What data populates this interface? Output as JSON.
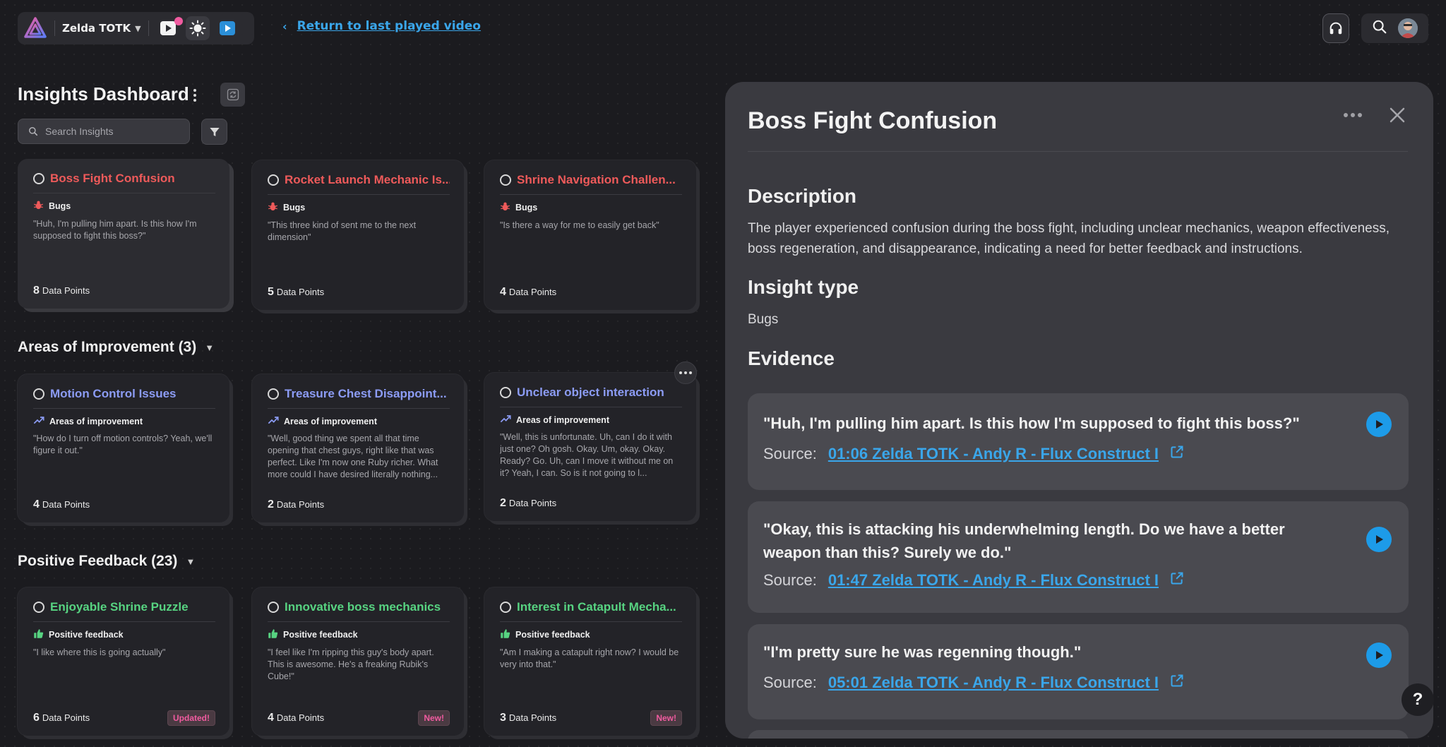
{
  "topbar": {
    "project_name": "Zelda TOTK",
    "return_label": "Return to last played video"
  },
  "dashboard": {
    "title": "Insights Dashboard",
    "search_placeholder": "Search Insights"
  },
  "bugs": {
    "cards": [
      {
        "title": "Boss Fight Confusion",
        "tag": "Bugs",
        "quote": "\"Huh, I'm pulling him apart. Is this how I'm supposed to fight this boss?\"",
        "count": "8",
        "count_label": "Data Points"
      },
      {
        "title": "Rocket Launch Mechanic Is...",
        "tag": "Bugs",
        "quote": "\"This three kind of sent me to the next dimension\"",
        "count": "5",
        "count_label": "Data Points"
      },
      {
        "title": "Shrine Navigation Challen...",
        "tag": "Bugs",
        "quote": "\"Is there a way for me to easily get back\"",
        "count": "4",
        "count_label": "Data Points"
      }
    ]
  },
  "improvement": {
    "heading": "Areas of Improvement (3)",
    "cards": [
      {
        "title": "Motion Control Issues",
        "tag": "Areas of improvement",
        "quote": "\"How do I turn off motion controls? Yeah, we'll figure it out.\"",
        "count": "4",
        "count_label": "Data Points"
      },
      {
        "title": "Treasure Chest Disappoint...",
        "tag": "Areas of improvement",
        "quote": "\"Well, good thing we spent all that time opening that chest guys, right like that was perfect. Like I'm now one Ruby richer. What more could I have desired literally nothing...",
        "count": "2",
        "count_label": "Data Points"
      },
      {
        "title": "Unclear object interaction",
        "tag": "Areas of improvement",
        "quote": "\"Well, this is unfortunate. Uh, can I do it with just one? Oh gosh. Okay. Um, okay. Okay. Ready? Go. Uh, can I move it without me on it? Yeah, I can. So is it not going to l...",
        "count": "2",
        "count_label": "Data Points"
      }
    ]
  },
  "positive": {
    "heading": "Positive Feedback (23)",
    "cards": [
      {
        "title": "Enjoyable Shrine Puzzle",
        "tag": "Positive feedback",
        "quote": "\"I like where this is going actually\"",
        "count": "6",
        "count_label": "Data Points",
        "badge": "Updated!"
      },
      {
        "title": "Innovative boss mechanics",
        "tag": "Positive feedback",
        "quote": "\"I feel like I'm ripping this guy's body apart. This is awesome. He's a freaking Rubik's Cube!\"",
        "count": "4",
        "count_label": "Data Points",
        "badge": "New!"
      },
      {
        "title": "Interest in Catapult Mecha...",
        "tag": "Positive feedback",
        "quote": "\"Am I making a catapult right now? I would be very into that.\"",
        "count": "3",
        "count_label": "Data Points",
        "badge": "New!"
      }
    ]
  },
  "panel": {
    "title": "Boss Fight Confusion",
    "description_heading": "Description",
    "description": "The player experienced confusion during the boss fight, including unclear mechanics, weapon effectiveness, boss regeneration, and disappearance, indicating a need for better feedback and instructions.",
    "type_heading": "Insight type",
    "type_value": "Bugs",
    "evidence_heading": "Evidence",
    "source_label": "Source:",
    "evidence": [
      {
        "quote": "\"Huh, I'm pulling him apart. Is this how I'm supposed to fight this boss?\"",
        "source": "01:06 Zelda TOTK - Andy R - Flux Construct I"
      },
      {
        "quote": "\"Okay, this is attacking his underwhelming length. Do we have a better weapon than this? Surely we do.\"",
        "source": "01:47 Zelda TOTK - Andy R - Flux Construct I"
      },
      {
        "quote": "\"I'm pretty sure he was regenning though.\"",
        "source": "05:01 Zelda TOTK - Andy R - Flux Construct I"
      }
    ]
  },
  "help_label": "?",
  "colors": {
    "bugs": "#ee5a5a",
    "improvement": "#8c9cf5",
    "positive": "#57d381",
    "accent": "#3aa6ea",
    "badge": "#f15ba0"
  }
}
